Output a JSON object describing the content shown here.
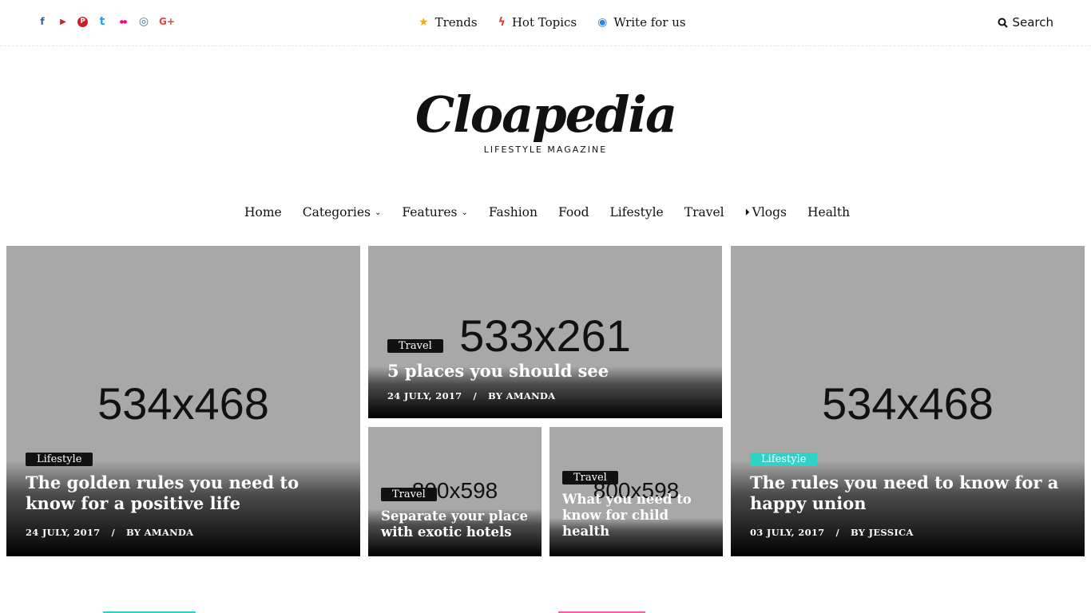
{
  "social": [
    {
      "icon": "facebook-icon",
      "glyph": "f",
      "color": "#3b5998"
    },
    {
      "icon": "youtube-icon",
      "glyph": "▶",
      "color": "#cd201f"
    },
    {
      "icon": "pinterest-icon",
      "glyph": "P",
      "color": "#cb2027"
    },
    {
      "icon": "twitter-icon",
      "glyph": "t",
      "color": "#1da1f2"
    },
    {
      "icon": "flickr-icon",
      "glyph": "●●",
      "color": "#ff0084"
    },
    {
      "icon": "instagram-icon",
      "glyph": "◎",
      "color": "#3f729b"
    },
    {
      "icon": "google-plus-icon",
      "glyph": "G+",
      "color": "#dd4b39"
    }
  ],
  "toplinks": {
    "trends": {
      "label": "Trends",
      "icon": "star-icon",
      "glyph": "★",
      "color": "#f5a623"
    },
    "hot_topics": {
      "label": "Hot Topics",
      "icon": "bolt-icon",
      "glyph": "ϟ",
      "color": "#e53935"
    },
    "write": {
      "label": "Write for us",
      "icon": "user-circle-icon",
      "glyph": "◉",
      "color": "#2e86de"
    }
  },
  "search": {
    "label": "Search",
    "icon": "search-icon"
  },
  "logo": {
    "brand": "Cloapedia",
    "tagline": "LIFESTYLE MAGAZINE"
  },
  "nav": {
    "home": "Home",
    "categories": "Categories",
    "features": "Features",
    "fashion": "Fashion",
    "food": "Food",
    "lifestyle": "Lifestyle",
    "travel": "Travel",
    "vlogs": "Vlogs",
    "health": "Health"
  },
  "cards": {
    "c1": {
      "placeholder": "534x468",
      "badge": "Lifestyle",
      "title": "The golden rules you need to know for a positive life",
      "date": "24 JULY, 2017",
      "sep": "/",
      "author": "BY AMANDA"
    },
    "c2": {
      "placeholder": "533x261",
      "badge": "Travel",
      "title": "5 places you should see",
      "date": "24 JULY, 2017",
      "sep": "/",
      "author": "BY AMANDA"
    },
    "c3": {
      "placeholder": "800x598",
      "badge": "Travel",
      "title": "Separate your place with exotic hotels"
    },
    "c4": {
      "placeholder": "800x598",
      "badge": "Travel",
      "title": "What you need to know for child health"
    },
    "c5": {
      "placeholder": "534x468",
      "badge": "Lifestyle",
      "title": "The rules you need to know for a happy union",
      "date": "03 JULY, 2017",
      "sep": "/",
      "author": "BY JESSICA"
    }
  },
  "colors": {
    "badge_default": "#111111",
    "badge_accent": "#2ed3c6",
    "bottom_accent_1": "#2ed3c6",
    "bottom_accent_2": "#ff5ea8"
  }
}
